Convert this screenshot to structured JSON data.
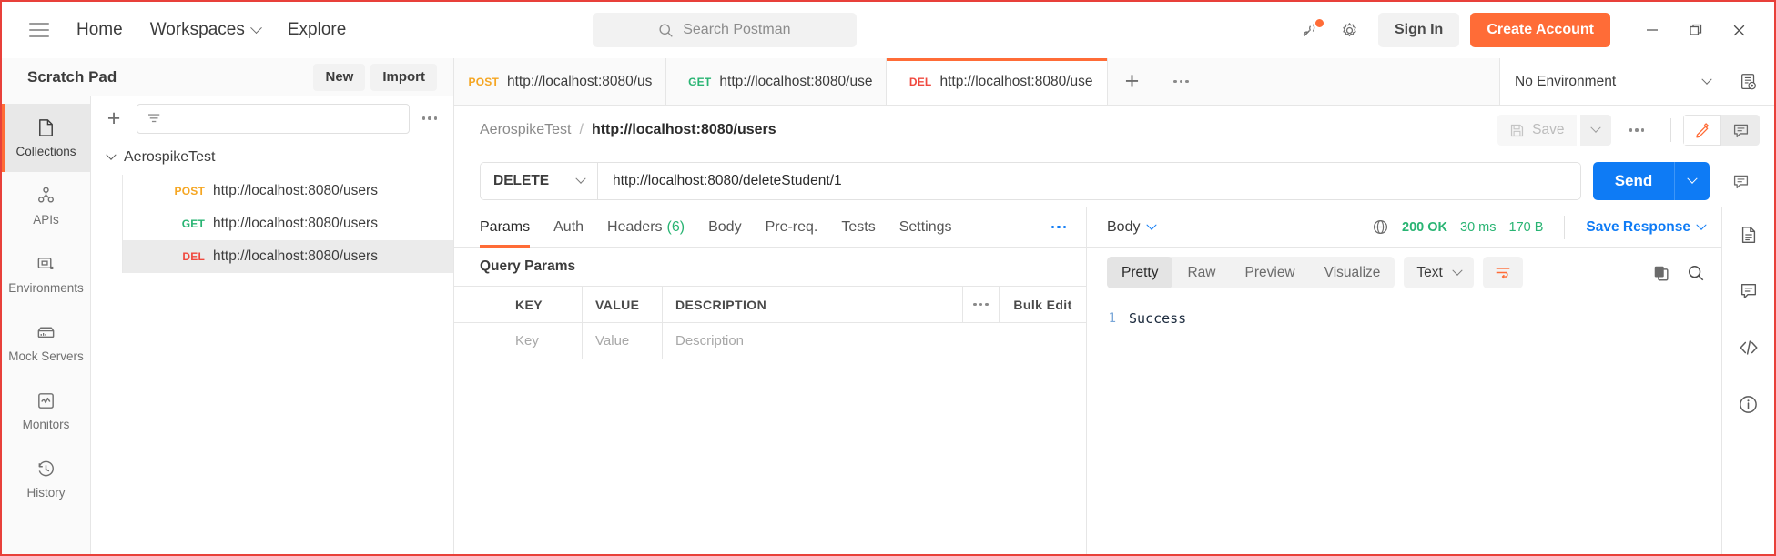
{
  "header": {
    "menu_icon": "hamburger-icon",
    "nav": [
      {
        "label": "Home",
        "has_chevron": false
      },
      {
        "label": "Workspaces",
        "has_chevron": true
      },
      {
        "label": "Explore",
        "has_chevron": false
      }
    ],
    "search": {
      "placeholder": "Search Postman",
      "icon": "search-icon",
      "value": ""
    },
    "satellite_icon": "satellite-icon",
    "settings_icon": "gear-icon",
    "sign_in_label": "Sign In",
    "create_account_label": "Create Account",
    "window_controls": {
      "minimize": "minimize-icon",
      "maximize": "restore-icon",
      "close": "close-icon"
    },
    "accent_color": "#ff6c37"
  },
  "sidebar": {
    "workspace_title": "Scratch Pad",
    "new_label": "New",
    "import_label": "Import",
    "rail_items": [
      {
        "label": "Collections",
        "icon": "collections-icon",
        "active": true
      },
      {
        "label": "APIs",
        "icon": "apis-icon",
        "active": false
      },
      {
        "label": "Environments",
        "icon": "environments-icon",
        "active": false
      },
      {
        "label": "Mock Servers",
        "icon": "mock-servers-icon",
        "active": false
      },
      {
        "label": "Monitors",
        "icon": "monitors-icon",
        "active": false
      },
      {
        "label": "History",
        "icon": "history-icon",
        "active": false
      }
    ],
    "filter_placeholder": "",
    "collection": {
      "name": "AerospikeTest",
      "expanded": true,
      "requests": [
        {
          "method": "POST",
          "url": "http://localhost:8080/users",
          "selected": false,
          "color": "#f5a623"
        },
        {
          "method": "GET",
          "url": "http://localhost:8080/users",
          "selected": false,
          "color": "#29b473"
        },
        {
          "method": "DEL",
          "url": "http://localhost:8080/users",
          "selected": true,
          "color": "#f0483e"
        }
      ]
    }
  },
  "tabs": {
    "open": [
      {
        "method": "POST",
        "title": "http://localhost:8080/us",
        "active": false,
        "color": "#f5a623"
      },
      {
        "method": "GET",
        "title": "http://localhost:8080/use",
        "active": false,
        "color": "#29b473"
      },
      {
        "method": "DEL",
        "title": "http://localhost:8080/use",
        "active": true,
        "color": "#f0483e"
      }
    ],
    "new_tab_label": "+",
    "environment": {
      "selected": "No Environment",
      "eye_icon": "environment-quick-look-icon"
    }
  },
  "request": {
    "breadcrumb": {
      "collection": "AerospikeTest",
      "separator": "/",
      "name": "http://localhost:8080/users"
    },
    "save_label": "Save",
    "save_icon": "floppy-disk-icon",
    "more_icon": "ellipsis-icon",
    "edit_icon": "pencil-icon",
    "comment_icon": "comment-icon",
    "method": "DELETE",
    "url": "http://localhost:8080/deleteStudent/1",
    "send_label": "Send",
    "tabs": [
      {
        "label": "Params",
        "active": true,
        "count": ""
      },
      {
        "label": "Auth",
        "active": false,
        "count": ""
      },
      {
        "label": "Headers",
        "active": false,
        "count": "(6)"
      },
      {
        "label": "Body",
        "active": false,
        "count": ""
      },
      {
        "label": "Pre-req.",
        "active": false,
        "count": ""
      },
      {
        "label": "Tests",
        "active": false,
        "count": ""
      },
      {
        "label": "Settings",
        "active": false,
        "count": ""
      }
    ],
    "query_params": {
      "title": "Query Params",
      "columns": [
        "",
        "KEY",
        "VALUE",
        "DESCRIPTION"
      ],
      "bulk_edit_label": "Bulk Edit",
      "rows": [
        {
          "key_placeholder": "Key",
          "value_placeholder": "Value",
          "description_placeholder": "Description"
        }
      ]
    }
  },
  "response": {
    "body_selector": "Body",
    "globe_icon": "globe-icon",
    "status": "200 OK",
    "time": "30 ms",
    "size": "170 B",
    "save_response_label": "Save Response",
    "view_tabs": [
      {
        "label": "Pretty",
        "active": true
      },
      {
        "label": "Raw",
        "active": false
      },
      {
        "label": "Preview",
        "active": false
      },
      {
        "label": "Visualize",
        "active": false
      }
    ],
    "format": "Text",
    "wrap_icon": "word-wrap-icon",
    "copy_icon": "copy-icon",
    "search_icon": "search-icon",
    "body_lines": [
      {
        "number": "1",
        "text": "Success"
      }
    ]
  },
  "far_rail": [
    {
      "icon": "documentation-icon"
    },
    {
      "icon": "comments-icon"
    },
    {
      "icon": "code-snippet-icon"
    },
    {
      "icon": "info-icon"
    }
  ]
}
